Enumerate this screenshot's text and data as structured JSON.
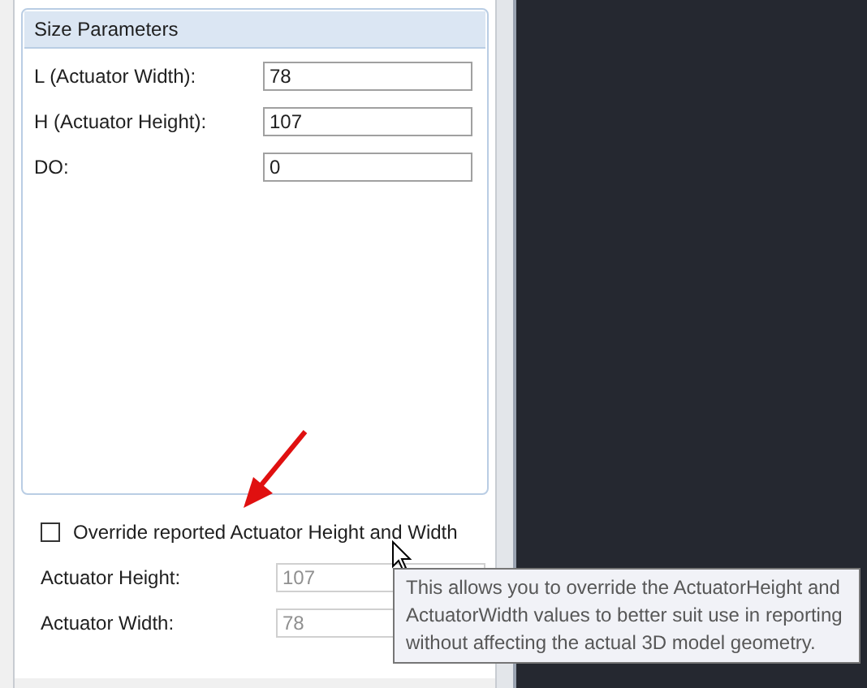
{
  "size_parameters": {
    "title": "Size Parameters",
    "fields": [
      {
        "label": "L (Actuator Width):",
        "value": "78"
      },
      {
        "label": "H (Actuator Height):",
        "value": "107"
      },
      {
        "label": "DO:",
        "value": "0"
      }
    ]
  },
  "override": {
    "label": "Override reported Actuator Height and Width",
    "checked": false
  },
  "reported_fields": [
    {
      "label": "Actuator Height:",
      "value": "107",
      "disabled": true
    },
    {
      "label": "Actuator Width:",
      "value": "78",
      "disabled": true
    }
  ],
  "tooltip": {
    "text": "This allows you to override the ActuatorHeight and ActuatorWidth values to better suit use in reporting without affecting the actual 3D model geometry."
  }
}
